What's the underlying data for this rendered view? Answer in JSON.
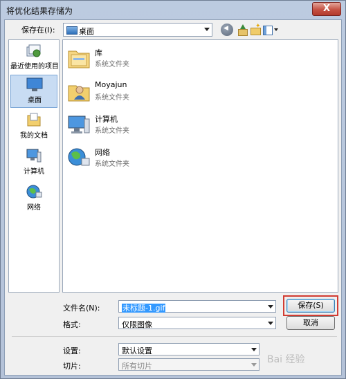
{
  "window": {
    "title": "将优化结果存储为",
    "close_symbol": "X"
  },
  "toolbar": {
    "lookin_label": "保存在(I):",
    "lookin_value": "桌面",
    "back_icon": "back-icon",
    "up_icon": "up-folder-icon",
    "new_folder_icon": "new-folder-icon",
    "view_icon": "view-menu-icon"
  },
  "places": [
    {
      "label": "最近使用的项目",
      "icon": "recent-items-icon",
      "selected": false
    },
    {
      "label": "桌面",
      "icon": "desktop-icon",
      "selected": true
    },
    {
      "label": "我的文档",
      "icon": "documents-icon",
      "selected": false
    },
    {
      "label": "计算机",
      "icon": "computer-icon",
      "selected": false
    },
    {
      "label": "网络",
      "icon": "network-icon",
      "selected": false
    }
  ],
  "files": [
    {
      "name": "库",
      "type": "系统文件夹",
      "icon": "library-icon"
    },
    {
      "name": "Moyajun",
      "type": "系统文件夹",
      "icon": "user-folder-icon"
    },
    {
      "name": "计算机",
      "type": "系统文件夹",
      "icon": "computer-icon"
    },
    {
      "name": "网络",
      "type": "系统文件夹",
      "icon": "network-icon"
    }
  ],
  "form": {
    "filename_label": "文件名(N):",
    "filename_value": "未标题-1.gif",
    "format_label": "格式:",
    "format_value": "仅限图像",
    "settings_label": "设置:",
    "settings_value": "默认设置",
    "slices_label": "切片:",
    "slices_value": "所有切片"
  },
  "buttons": {
    "save": "保存(S)",
    "cancel": "取消"
  },
  "watermark": "Bai 经验",
  "colors": {
    "highlight": "#d23c32",
    "selection": "#3399ff"
  }
}
